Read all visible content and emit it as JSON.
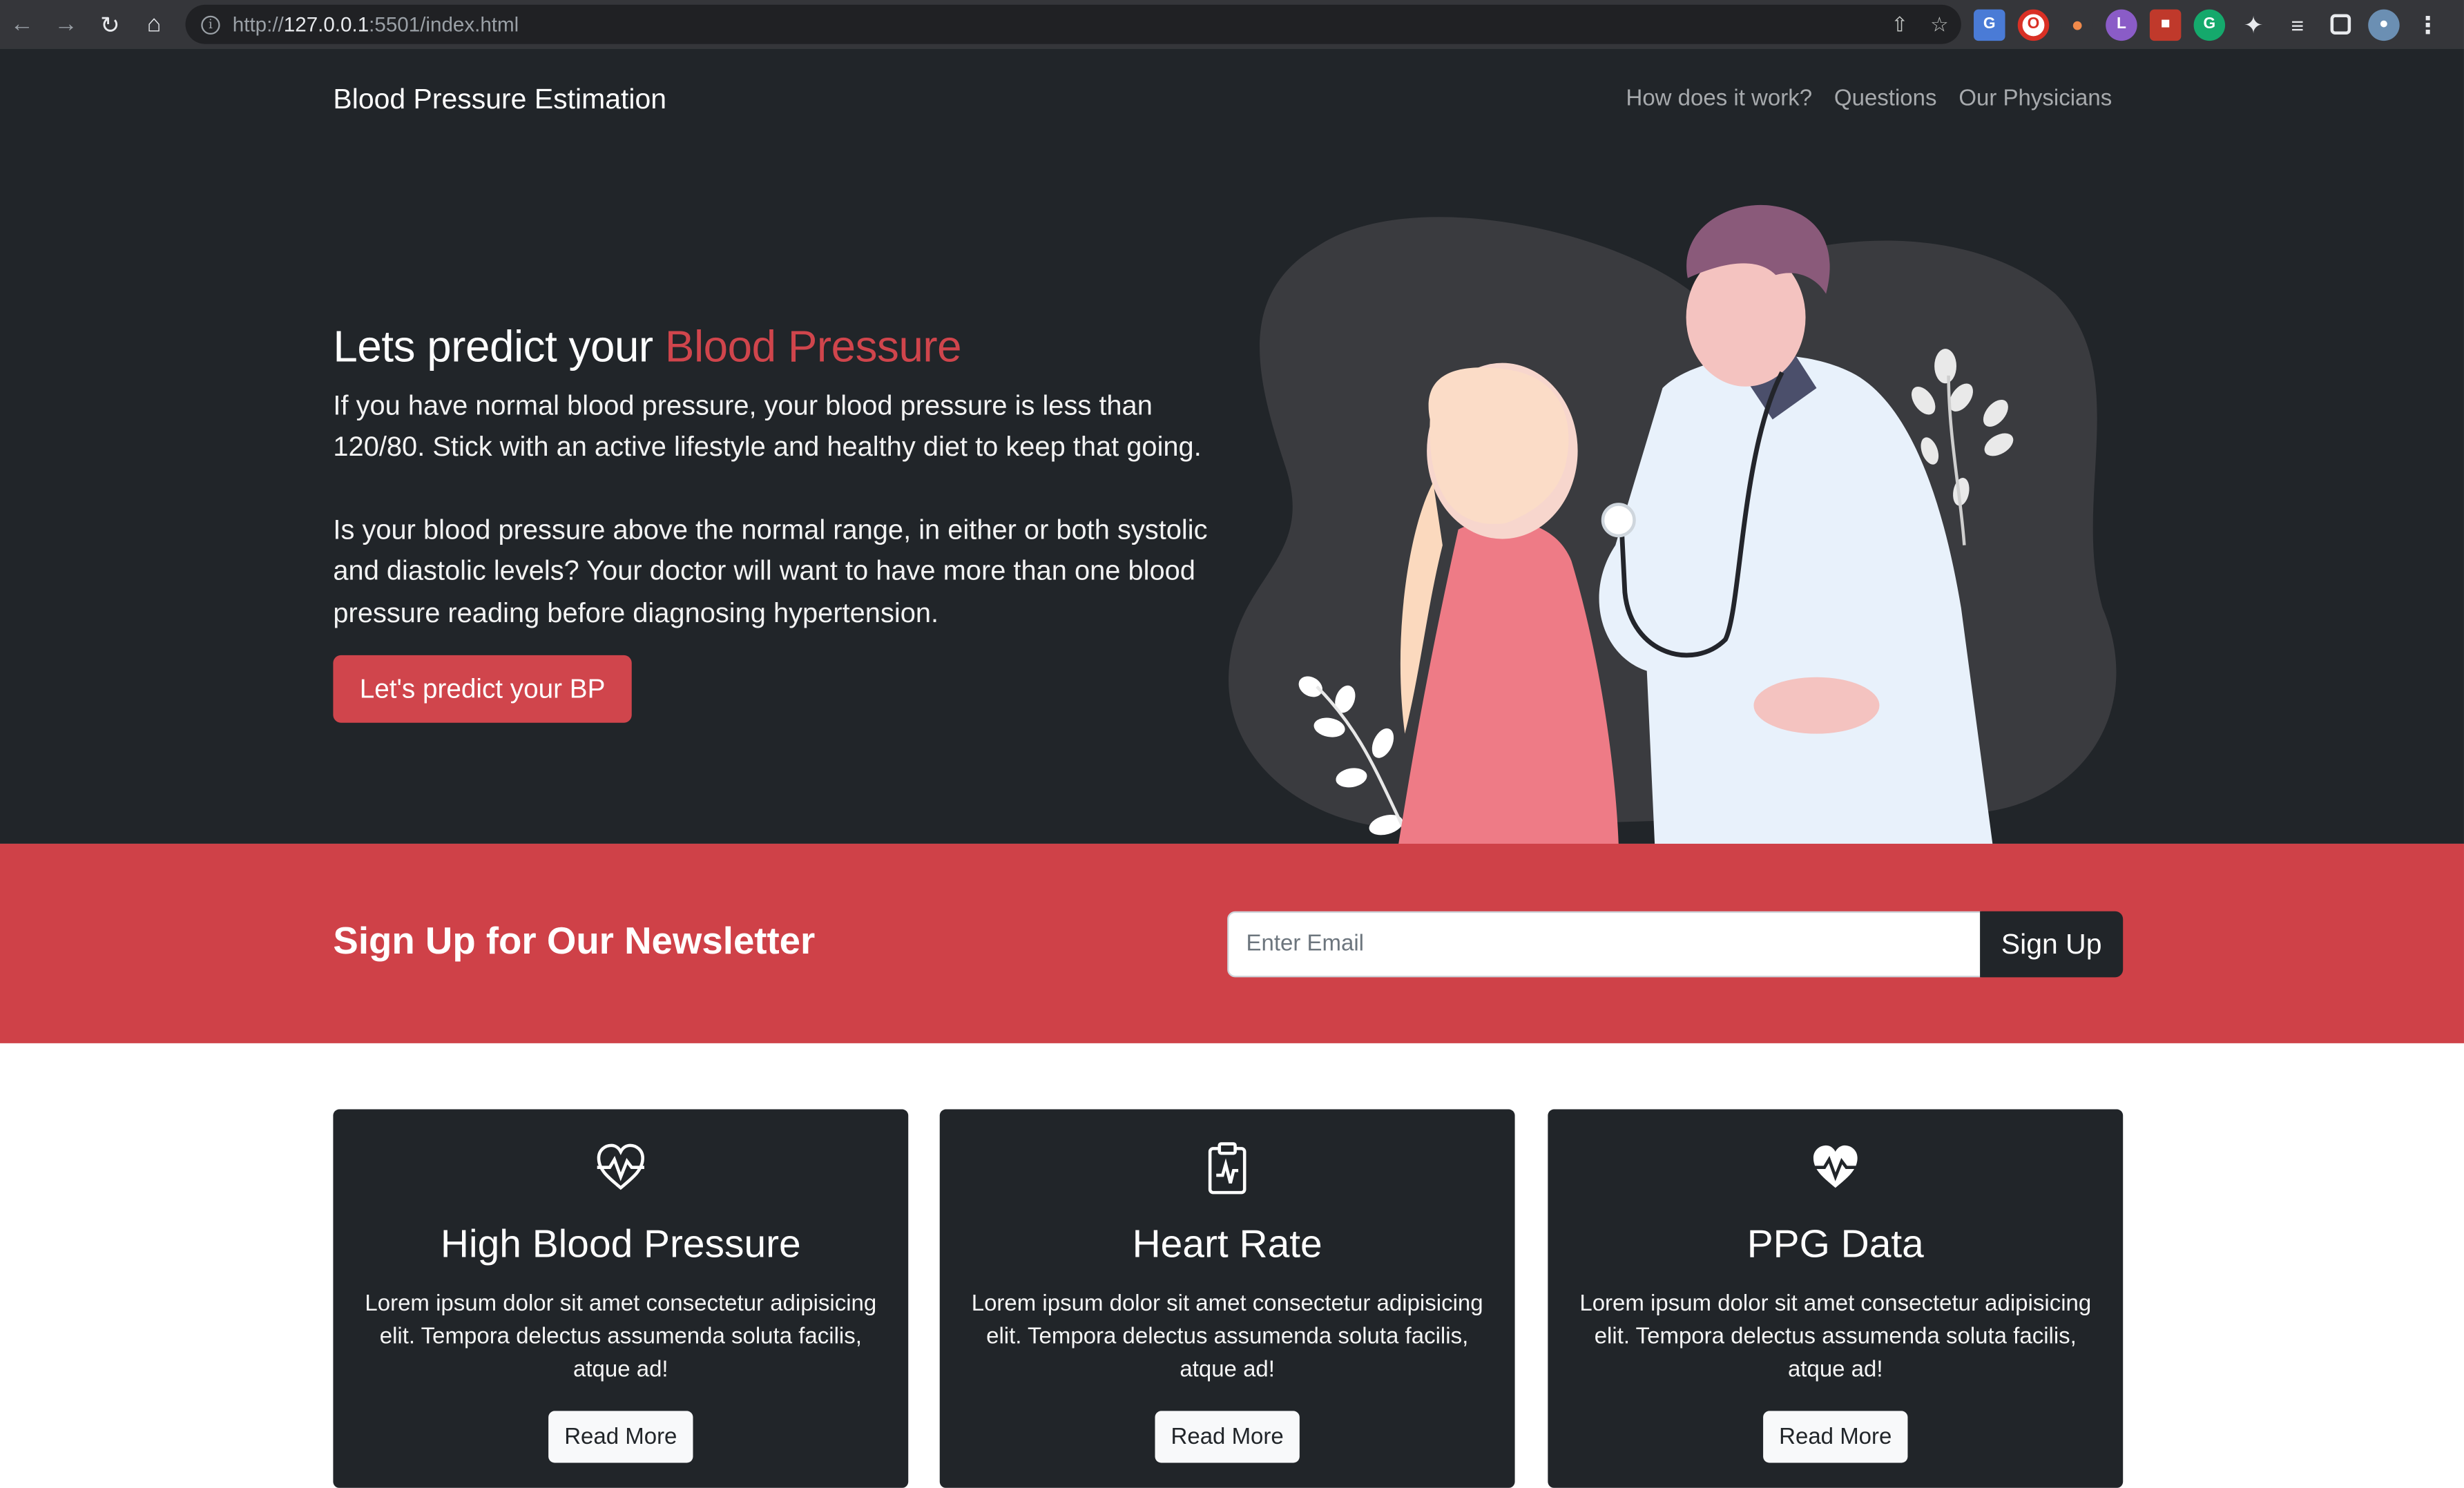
{
  "browser": {
    "url_prefix": "http://",
    "url_host": "127.0.0.1",
    "url_rest": ":5501/index.html"
  },
  "header": {
    "brand": "Blood Pressure Estimation",
    "nav": [
      "How does it work?",
      "Questions",
      "Our Physicians"
    ]
  },
  "hero": {
    "title_main": "Lets predict your ",
    "title_accent": "Blood Pressure",
    "paragraph1": "If you have normal blood pressure, your blood pressure is less than 120/80. Stick with an active lifestyle and healthy diet to keep that going.",
    "paragraph2": "Is your blood pressure above the normal range, in either or both systolic and diastolic levels? Your doctor will want to have more than one blood pressure reading before diagnosing hypertension.",
    "cta_label": "Let's predict your BP"
  },
  "newsletter": {
    "title": "Sign Up for Our Newsletter",
    "email_placeholder": "Enter Email",
    "button_label": "Sign Up"
  },
  "cards": [
    {
      "icon": "heart-pulse-outline-icon",
      "title": "High Blood Pressure",
      "text": "Lorem ipsum dolor sit amet consectetur adipisicing elit. Tempora delectus assumenda soluta facilis, atque ad!",
      "button": "Read More"
    },
    {
      "icon": "clipboard-pulse-icon",
      "title": "Heart Rate",
      "text": "Lorem ipsum dolor sit amet consectetur adipisicing elit. Tempora delectus assumenda soluta facilis, atque ad!",
      "button": "Read More"
    },
    {
      "icon": "heart-pulse-filled-icon",
      "title": "PPG Data",
      "text": "Lorem ipsum dolor sit amet consectetur adipisicing elit. Tempora delectus assumenda soluta facilis, atque ad!",
      "button": "Read More"
    }
  ],
  "colors": {
    "dark": "#212529",
    "accent": "#d0454c",
    "newsletter_bg": "#cf4148"
  }
}
